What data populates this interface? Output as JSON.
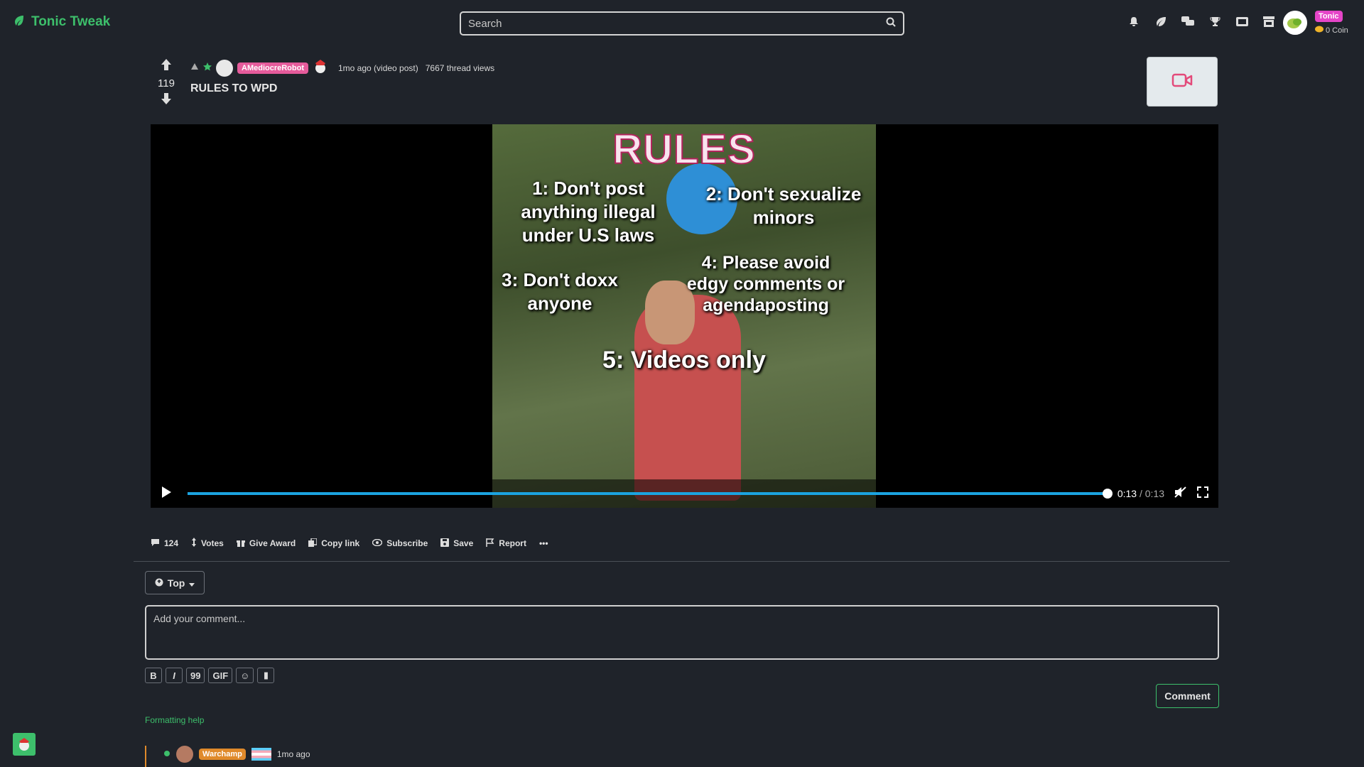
{
  "app": {
    "name": "Tonic Tweak",
    "brand_color": "#3dbf6b"
  },
  "search": {
    "placeholder": "Search"
  },
  "nav_icons": [
    "bell-icon",
    "leaf-icon",
    "chat-icon",
    "trophy-icon",
    "ticket-icon",
    "shop-icon"
  ],
  "user": {
    "name": "Tonic",
    "coins": "0 Coin"
  },
  "post": {
    "score": "119",
    "author": "AMediocreRobot",
    "time": "1mo ago (video post)",
    "views": "7667 thread views",
    "title": "RULES TO WPD"
  },
  "video": {
    "heading": "RULES",
    "rules": [
      "1: Don't post\nanything illegal\nunder U.S laws",
      "2: Don't sexualize\nminors",
      "3: Don't doxx\nanyone",
      "4: Please avoid\nedgy comments or\nagendaposting",
      "5: Videos only"
    ],
    "current_time": "0:13",
    "duration": "/ 0:13",
    "progress": 1.0
  },
  "actions": {
    "comments_count": "124",
    "votes": "Votes",
    "give_award": "Give Award",
    "copy_link": "Copy link",
    "subscribe": "Subscribe",
    "save": "Save",
    "report": "Report",
    "more": "•••"
  },
  "comments": {
    "sort": "Top",
    "placeholder": "Add your comment...",
    "format_buttons": [
      "B",
      "I",
      "99",
      "GIF",
      "☺",
      "▮"
    ],
    "submit": "Comment",
    "formatting_help": "Formatting help",
    "first": {
      "author": "Warchamp",
      "time": "1mo ago"
    }
  }
}
